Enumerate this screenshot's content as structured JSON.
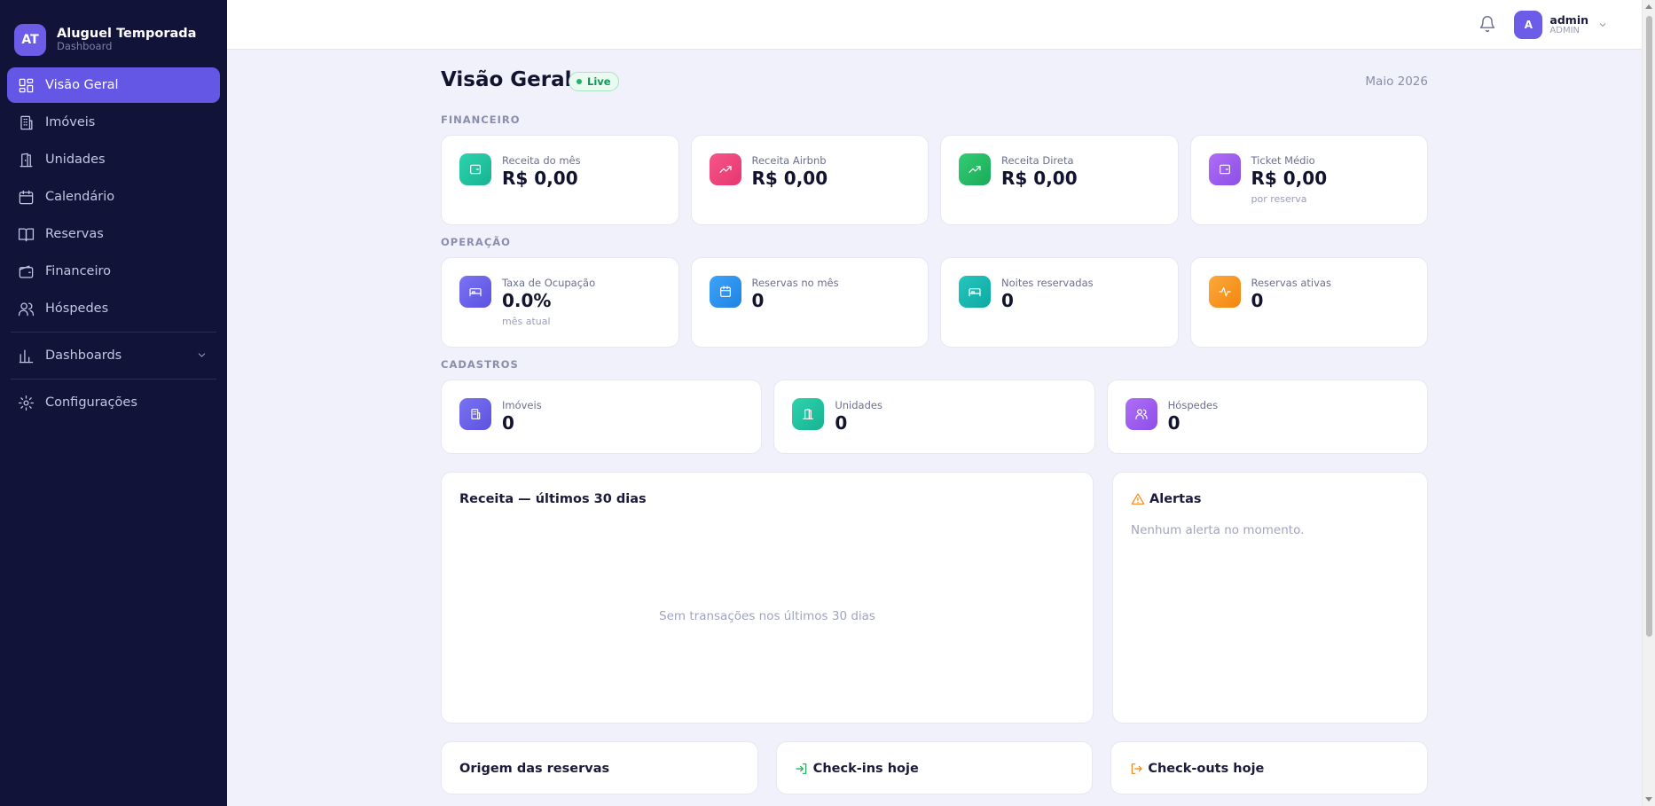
{
  "brand": {
    "initials": "AT",
    "title": "Aluguel Temporada",
    "subtitle": "Dashboard"
  },
  "sidebar": {
    "items": [
      {
        "label": "Visão Geral",
        "icon": "grid-icon"
      },
      {
        "label": "Imóveis",
        "icon": "building-icon"
      },
      {
        "label": "Unidades",
        "icon": "door-icon"
      },
      {
        "label": "Calendário",
        "icon": "calendar-icon"
      },
      {
        "label": "Reservas",
        "icon": "book-icon"
      },
      {
        "label": "Financeiro",
        "icon": "wallet-icon"
      },
      {
        "label": "Hóspedes",
        "icon": "users-icon"
      },
      {
        "label": "Dashboards",
        "icon": "bar-chart-icon"
      },
      {
        "label": "Configurações",
        "icon": "gear-icon"
      }
    ]
  },
  "topbar": {
    "user_initial": "A",
    "user_name": "admin",
    "user_role": "ADMIN"
  },
  "header": {
    "title": "Visão Geral",
    "badge": "Live",
    "month": "Maio 2026"
  },
  "financeiro": {
    "label": "FINANCEIRO",
    "cards": [
      {
        "label": "Receita do mês",
        "value": "R$ 0,00",
        "sub": ""
      },
      {
        "label": "Receita Airbnb",
        "value": "R$ 0,00",
        "sub": ""
      },
      {
        "label": "Receita Direta",
        "value": "R$ 0,00",
        "sub": ""
      },
      {
        "label": "Ticket Médio",
        "value": "R$ 0,00",
        "sub": "por reserva"
      }
    ]
  },
  "operacao": {
    "label": "OPERAÇÃO",
    "cards": [
      {
        "label": "Taxa de Ocupação",
        "value": "0.0%",
        "sub": "mês atual"
      },
      {
        "label": "Reservas no mês",
        "value": "0",
        "sub": ""
      },
      {
        "label": "Noites reservadas",
        "value": "0",
        "sub": ""
      },
      {
        "label": "Reservas ativas",
        "value": "0",
        "sub": ""
      }
    ]
  },
  "cadastros": {
    "label": "CADASTROS",
    "cards": [
      {
        "label": "Imóveis",
        "value": "0"
      },
      {
        "label": "Unidades",
        "value": "0"
      },
      {
        "label": "Hóspedes",
        "value": "0"
      }
    ]
  },
  "receita_panel": {
    "title": "Receita — últimos 30 dias",
    "empty": "Sem transações nos últimos 30 dias"
  },
  "alertas_panel": {
    "title": "Alertas",
    "empty": "Nenhum alerta no momento."
  },
  "bottom": {
    "origem": "Origem das reservas",
    "checkins": "Check-ins hoje",
    "checkouts": "Check-outs hoje"
  },
  "colors": {
    "sidebar_bg": "#111339",
    "accent": "#6457e6",
    "teal": "#1fc0a0",
    "pink": "#f0437a",
    "green": "#22c06a",
    "purple": "#9b5cf0",
    "indigo": "#6b63ee",
    "blue": "#2b8ff0",
    "cyan": "#19b8b0",
    "orange": "#f8951d"
  }
}
